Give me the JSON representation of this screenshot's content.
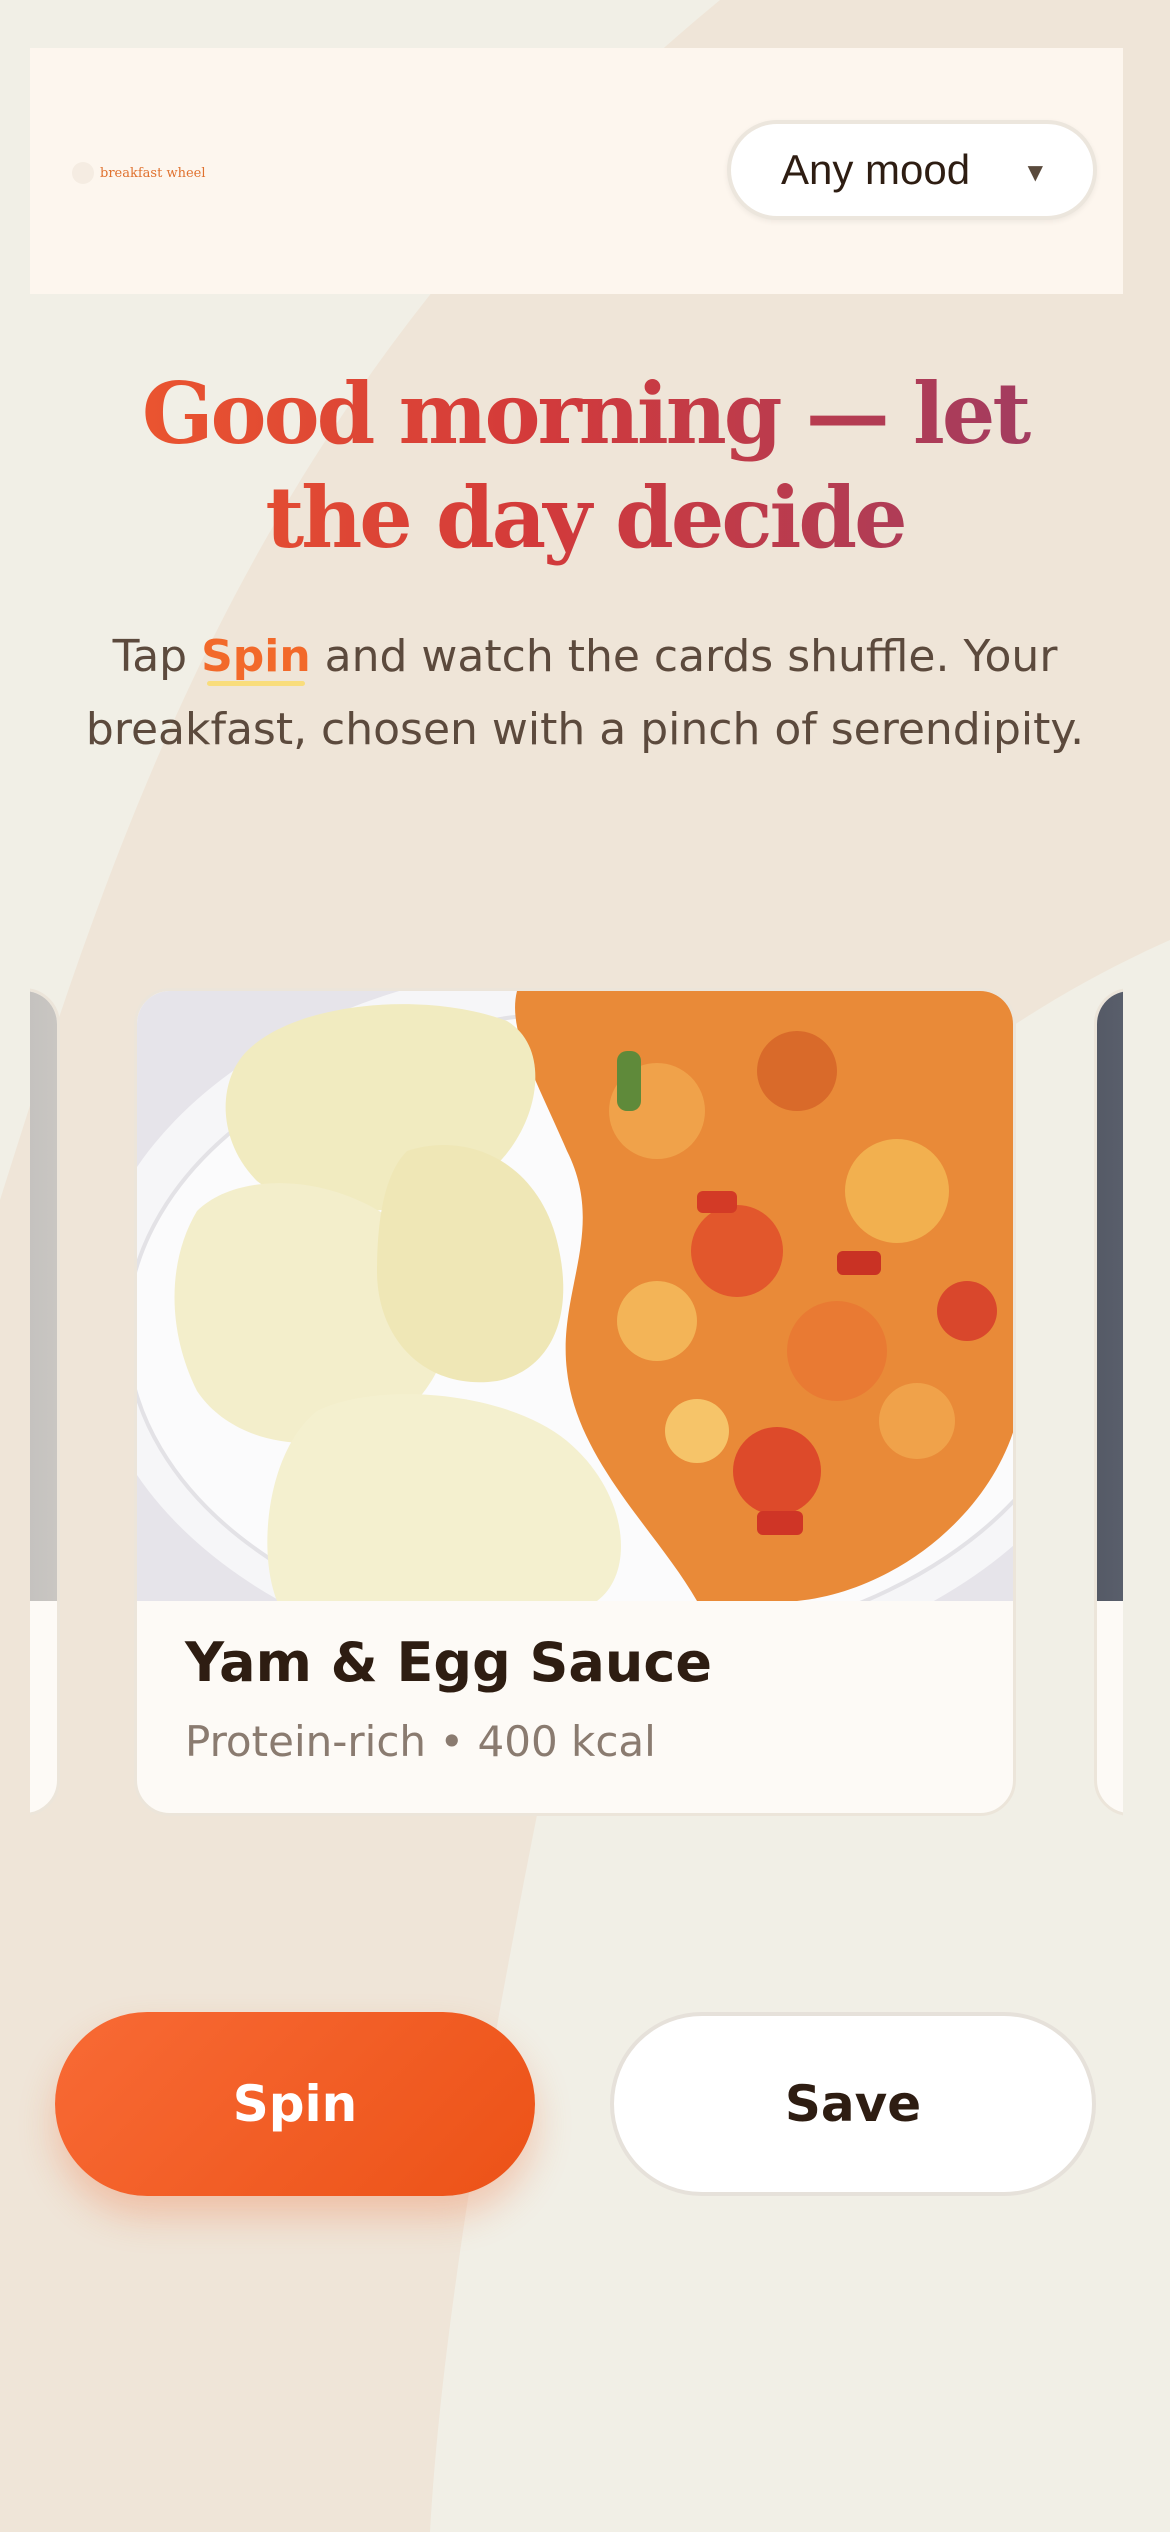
{
  "app": {
    "logo_text": "breakfast wheel"
  },
  "mood_select": {
    "selected": "Any mood",
    "caret_icon": "caret-down-icon"
  },
  "headline": "Good morning — let the day decide",
  "subtitle": {
    "before": "Tap ",
    "highlight": "Spin",
    "after": " and watch the cards shuffle. Your breakfast, chosen with a pinch of serendipity."
  },
  "cards": {
    "center": {
      "title": "Yam & Egg Sauce",
      "meta": "Protein-rich • 400 kcal"
    }
  },
  "buttons": {
    "spin": "Spin",
    "save": "Save"
  },
  "colors": {
    "accent": "#f2692a",
    "headline_start": "#ef5a2d",
    "headline_end": "#9b3d66",
    "background": "#f1efe6"
  }
}
